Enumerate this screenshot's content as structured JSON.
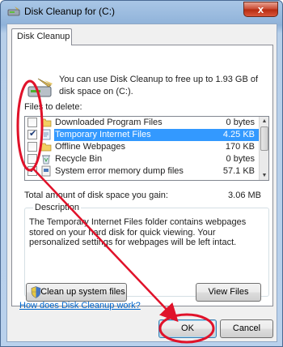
{
  "window": {
    "title": "Disk Cleanup for  (C:)",
    "close_glyph": "x"
  },
  "tab": {
    "label": "Disk Cleanup"
  },
  "intro": {
    "text": "You can use Disk Cleanup to free up to 1.93 GB of disk space on  (C:)."
  },
  "files": {
    "label": "Files to delete:",
    "items": [
      {
        "name": "Downloaded Program Files",
        "size": "0 bytes",
        "checked": false,
        "icon": "folder-icon"
      },
      {
        "name": "Temporary Internet Files",
        "size": "4.25 KB",
        "checked": true,
        "icon": "temp-file-icon",
        "selected": true
      },
      {
        "name": "Offline Webpages",
        "size": "170 KB",
        "checked": false,
        "icon": "folder-icon"
      },
      {
        "name": "Recycle Bin",
        "size": "0 bytes",
        "checked": false,
        "icon": "recycle-bin-icon"
      },
      {
        "name": "System error memory dump files",
        "size": "57.1 KB",
        "checked": true,
        "icon": "system-file-icon"
      }
    ]
  },
  "total": {
    "label": "Total amount of disk space you gain:",
    "value": "3.06 MB"
  },
  "description": {
    "title": "Description",
    "text": "The Temporary Internet Files folder contains webpages stored on your hard disk for quick viewing. Your personalized settings for webpages will be left intact."
  },
  "buttons": {
    "clean_system": "Clean up system files",
    "view_files": "View Files",
    "ok": "OK",
    "cancel": "Cancel"
  },
  "help_link": "How does Disk Cleanup work?",
  "colors": {
    "annotation": "#e0122a",
    "selection": "#3399ff",
    "link": "#0066cc"
  }
}
